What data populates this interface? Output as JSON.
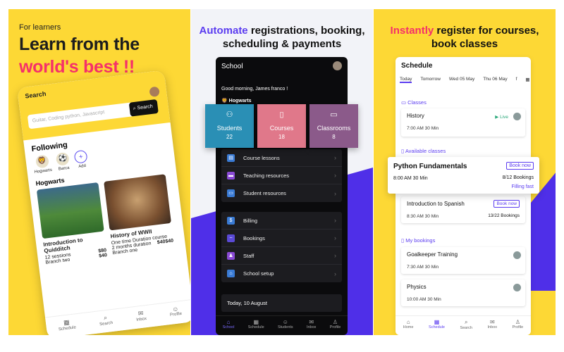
{
  "panel1": {
    "eyebrow": "For learners",
    "headline_line1": "Learn from the",
    "headline_line2": "world's best !!",
    "phone": {
      "search_title": "Search",
      "search_placeholder": "Guitar, Coding python, Javascript",
      "search_button": "Search",
      "following_title": "Following",
      "following": [
        "Hogwarts",
        "Barca",
        "Add"
      ],
      "school_name": "Hogwarts",
      "courses": [
        {
          "title": "Introduction to Quidditch",
          "line1": "12 sessions",
          "price1": "$80",
          "line2": "Branch two",
          "price2": "$40"
        },
        {
          "title": "History of WWII",
          "line1": "One time Duration course",
          "price1": "$40",
          "line2": "2 months duration",
          "price2": "$40",
          "line3": "Branch one"
        }
      ],
      "nav": [
        "Schedule",
        "Search",
        "Inbox",
        "Profile"
      ]
    }
  },
  "panel2": {
    "headline_accent": "Automate",
    "headline_rest1": " registrations, booking,",
    "headline_line2": "scheduling & payments",
    "phone": {
      "title": "School",
      "greeting": "Good morning, James franco !",
      "school_name": "Hogwarts",
      "tiles": [
        {
          "label": "Students",
          "count": "22",
          "color": "#2a8fb5"
        },
        {
          "label": "Courses",
          "count": "18",
          "color": "#e0788a"
        },
        {
          "label": "Classrooms",
          "count": "8",
          "color": "#8b5a8a"
        }
      ],
      "menu_group1": [
        "Course lessons",
        "Teaching resources",
        "Student resources"
      ],
      "menu_group2": [
        "Billing",
        "Bookings",
        "Staff",
        "School setup"
      ],
      "today": "Today,  10 August",
      "nav": [
        "School",
        "Schedule",
        "Students",
        "Inbox",
        "Profile"
      ]
    }
  },
  "panel3": {
    "headline_accent": "Instantly",
    "headline_rest1": " register for courses,",
    "headline_line2": "book classes",
    "phone": {
      "title": "Schedule",
      "tabs": [
        "Today",
        "Tomorrow",
        "Wed 05 May",
        "Thu 06 May",
        "f"
      ],
      "classes_label": "Classes",
      "class1": {
        "title": "History",
        "time": "7:00 AM  30 Min",
        "status": "Live"
      },
      "available_label": "Available classes",
      "popup": {
        "title": "Python Fundamentals",
        "button": "Book now",
        "time": "8:00 AM  30 Min",
        "bookings": "8/12 Bookings",
        "status": "Filling fast"
      },
      "class2": {
        "title": "Introduction to Spanish",
        "button": "Book now",
        "time": "8:30 AM  30 Min",
        "bookings": "13/22 Bookings"
      },
      "mybookings_label": "My bookings",
      "booking1": {
        "title": "Goalkeeper Training",
        "time": "7:30 AM  30 Min"
      },
      "booking2": {
        "title": "Physics",
        "time": "10:00 AM  30 Min"
      },
      "nav": [
        "Home",
        "Schedule",
        "Search",
        "Inbox",
        "Profile"
      ]
    }
  }
}
